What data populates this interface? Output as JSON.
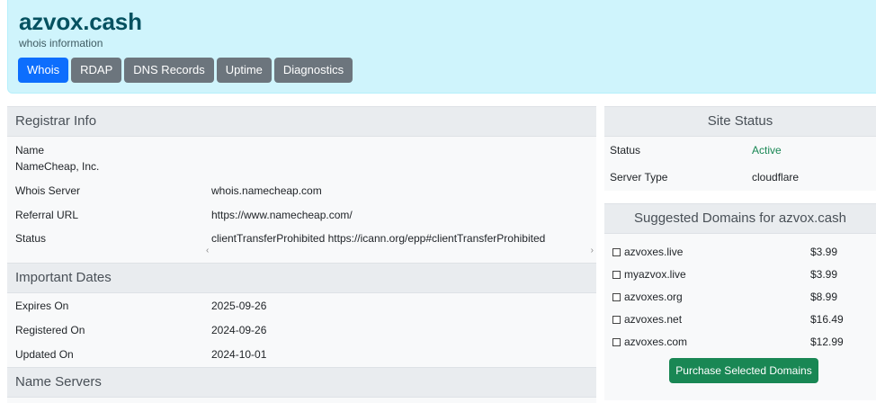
{
  "header": {
    "title": "azvox.cash",
    "subtitle": "whois information",
    "tabs": [
      "Whois",
      "RDAP",
      "DNS Records",
      "Uptime",
      "Diagnostics"
    ],
    "active_tab": "Whois"
  },
  "registrar": {
    "heading": "Registrar Info",
    "name_label": "Name",
    "name_value": "NameCheap, Inc.",
    "whois_server_label": "Whois Server",
    "whois_server_value": "whois.namecheap.com",
    "referral_label": "Referral URL",
    "referral_value": "https://www.namecheap.com/",
    "status_label": "Status",
    "status_value": "clientTransferProhibited https://icann.org/epp#clientTransferProhibited"
  },
  "dates": {
    "heading": "Important Dates",
    "expires_label": "Expires On",
    "expires_value": "2025-09-26",
    "registered_label": "Registered On",
    "registered_value": "2024-09-26",
    "updated_label": "Updated On",
    "updated_value": "2024-10-01"
  },
  "nameservers": {
    "heading": "Name Servers"
  },
  "site_status": {
    "heading": "Site Status",
    "status_label": "Status",
    "status_value": "Active",
    "server_label": "Server Type",
    "server_value": "cloudflare"
  },
  "suggested": {
    "heading": "Suggested Domains for azvox.cash",
    "domains": [
      {
        "name": "azvoxes.live",
        "price": "$3.99"
      },
      {
        "name": "myazvox.live",
        "price": "$3.99"
      },
      {
        "name": "azvoxes.org",
        "price": "$8.99"
      },
      {
        "name": "azvoxes.net",
        "price": "$16.49"
      },
      {
        "name": "azvoxes.com",
        "price": "$12.99"
      }
    ],
    "button_label": "Purchase Selected Domains"
  },
  "colors": {
    "header_bg": "#cff4fc",
    "title": "#055160",
    "tab_active": "#0d6efd",
    "tab": "#6c757d",
    "active_status": "#198754",
    "button": "#198754"
  }
}
